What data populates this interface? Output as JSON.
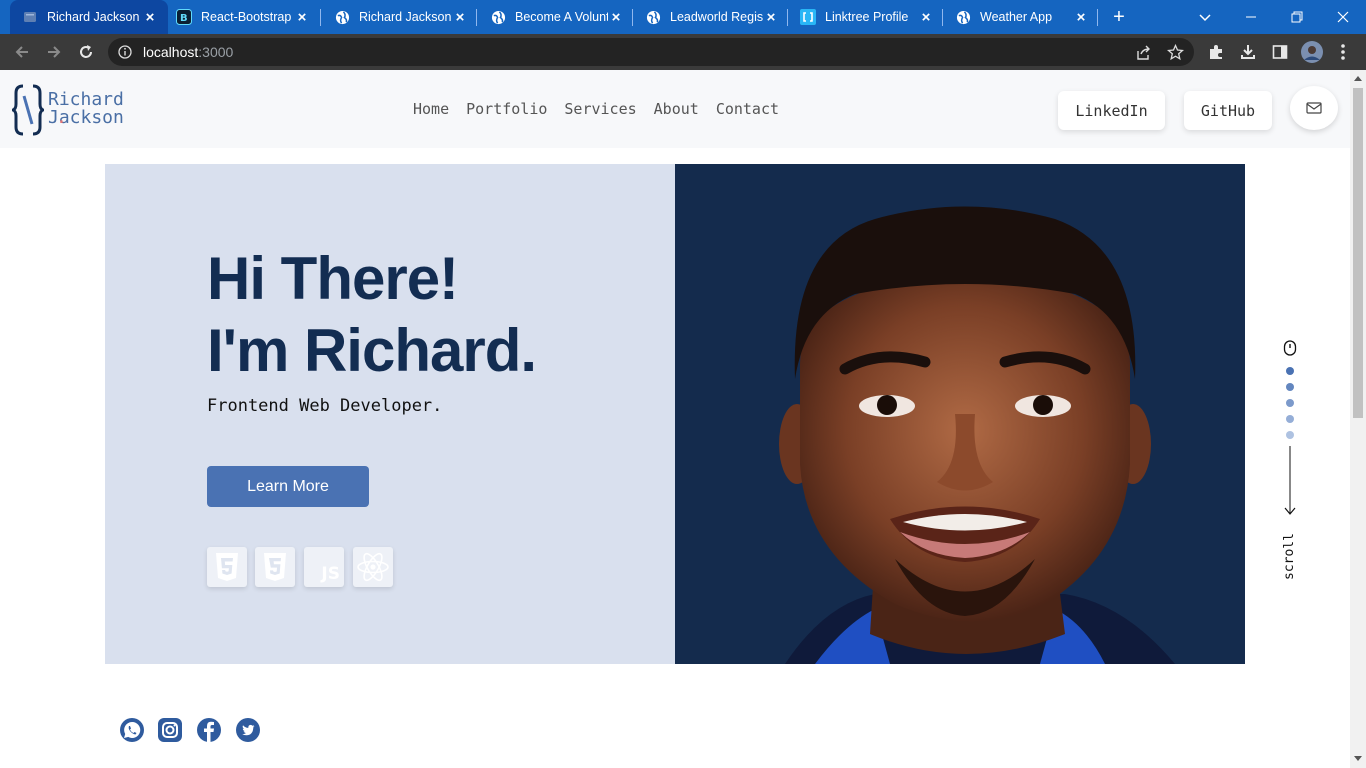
{
  "browser": {
    "tabs": [
      {
        "title": "Richard Jackson",
        "active": true,
        "icon": "page-icon"
      },
      {
        "title": "React-Bootstrap",
        "active": false,
        "icon": "bootstrap-icon"
      },
      {
        "title": "Richard Jackson",
        "active": false,
        "icon": "globe-icon"
      },
      {
        "title": "Become A Volunt",
        "active": false,
        "icon": "globe-icon"
      },
      {
        "title": "Leadworld Regist",
        "active": false,
        "icon": "globe-icon"
      },
      {
        "title": "Linktree Profile",
        "active": false,
        "icon": "brackets-icon"
      },
      {
        "title": "Weather App",
        "active": false,
        "icon": "globe-icon"
      }
    ],
    "new_tab_label": "+",
    "url_host": "localhost",
    "url_port": ":3000"
  },
  "site": {
    "logo": {
      "line1": "Richard",
      "line2": "Jackson",
      "dot": "."
    },
    "nav": [
      "Home",
      "Portfolio",
      "Services",
      "About",
      "Contact"
    ],
    "linkedin_label": "LinkedIn",
    "github_label": "GitHub"
  },
  "hero": {
    "heading_line1": "Hi There!",
    "heading_line2": "I'm Richard.",
    "subtitle": "Frontend Web Developer.",
    "cta_label": "Learn More",
    "tech_icons": [
      "html5-icon",
      "css3-icon",
      "javascript-icon",
      "react-icon"
    ],
    "js_text": "JS"
  },
  "scroll": {
    "label": "scroll"
  },
  "social": [
    "whatsapp-icon",
    "instagram-icon",
    "facebook-icon",
    "twitter-icon"
  ],
  "colors": {
    "tab_bar": "#1565c0",
    "accent": "#4a72b3",
    "heading": "#132d52",
    "hero_left_bg": "#d9e0ee",
    "hero_right_bg": "#142b4d"
  }
}
